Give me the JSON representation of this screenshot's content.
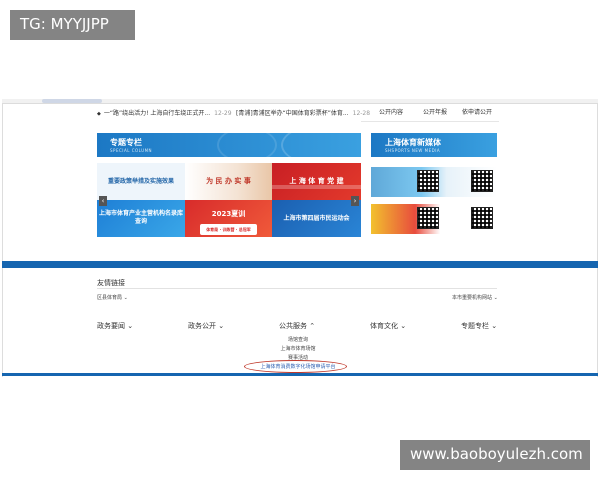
{
  "watermark": {
    "top_left": "TG: MYYJJPP",
    "bottom_right": "www.baoboyulezh.com"
  },
  "news": [
    {
      "bullet": "◆",
      "text": "一“路”绕出活力! 上海自行车绕正式开...",
      "date": "12-29"
    },
    {
      "bullet": "◆",
      "text": "[青浦]青浦区举办“中国体育彩票杯”体育...",
      "date": "12-28"
    }
  ],
  "tabs": [
    "公开内容",
    "公开年报",
    "依申请公开"
  ],
  "special_column": {
    "title": "专题专栏",
    "subtitle": "SPECIAL COLUMN"
  },
  "new_media": {
    "title": "上海体育新媒体",
    "subtitle": "SHSPORTS NEW MEDIA"
  },
  "banners": [
    {
      "label": "重要政策举措及实施效果"
    },
    {
      "label": "为 民 办 实 事"
    },
    {
      "label": "上 海 体 育 党 建"
    },
    {
      "label": "上海市体育产业主营机构名录库查询"
    },
    {
      "label": "2023夏训",
      "tag": "体育局 · 训练营 · 总冠军"
    },
    {
      "label": "上海市第四届市民运动会"
    }
  ],
  "carousel": {
    "prev": "‹",
    "next": "›"
  },
  "friend_links": {
    "title": "友情链接",
    "left_select": "区县体育局",
    "right_select": "本市重要机构网站"
  },
  "nav_groups": [
    {
      "label": "政务要闻"
    },
    {
      "label": "政务公开"
    },
    {
      "label": "公共服务"
    },
    {
      "label": "体育文化"
    },
    {
      "label": "专题专栏"
    }
  ],
  "public_service_items": [
    {
      "label": "场馆查询"
    },
    {
      "label": "上海市体育场馆"
    },
    {
      "label": "赛事活动"
    },
    {
      "label": "上海体育消费数字化场馆申请平台"
    }
  ],
  "colors": {
    "brand_blue": "#1565b0",
    "highlight_red": "#c0392b"
  }
}
